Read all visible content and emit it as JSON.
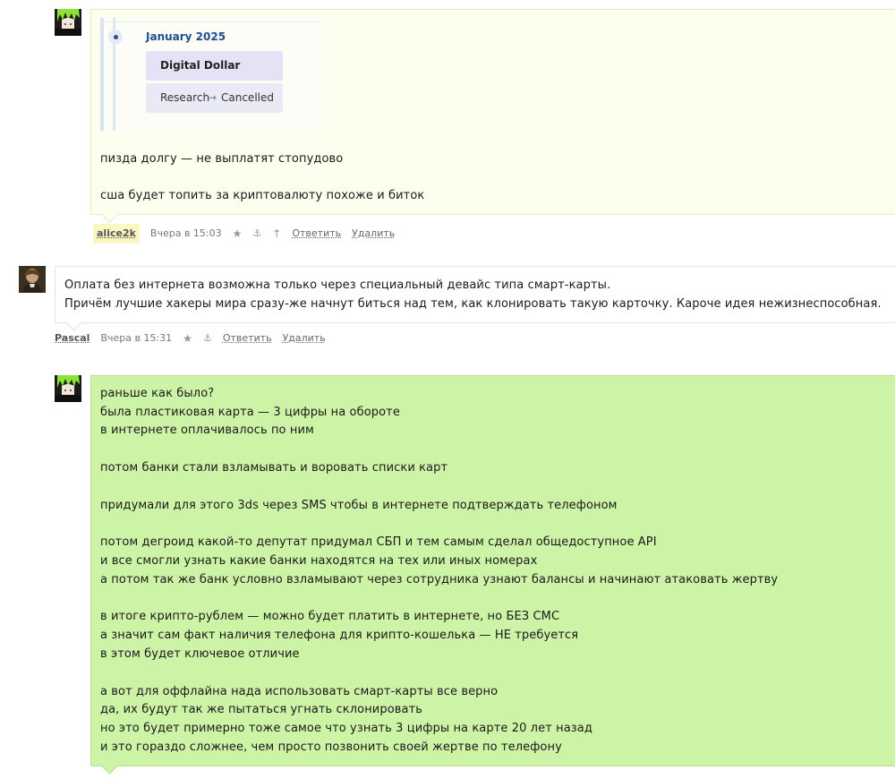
{
  "comments": [
    {
      "author": "alice2k",
      "avatar_icon": "green-hair-avatar",
      "embed": {
        "month": "January 2025",
        "title": "Digital Dollar",
        "status_from": "Research",
        "arrow": "→",
        "status_to": "Cancelled"
      },
      "lines": [
        "пизда долгу — не выплатят стопудово",
        "",
        "сша будет топить за криптовалюту похоже и биток"
      ],
      "time": "Вчера в 15:03",
      "star_icon": "★",
      "anchor_icon": "⚓",
      "up_icon": "↑",
      "reply_label": "Ответить",
      "delete_label": "Удалить"
    },
    {
      "author": "Pascal",
      "avatar_icon": "portrait-avatar",
      "lines": [
        "Оплата без интернета возможна только через специальный девайс типа смарт-карты.",
        "Причём лучшие хакеры мира сразу-же начнут биться над тем, как клонировать такую карточку. Кароче идея нежизнеспособная."
      ],
      "time": "Вчера в 15:31",
      "star_icon": "★",
      "anchor_icon": "⚓",
      "reply_label": "Ответить",
      "delete_label": "Удалить"
    },
    {
      "author": "alice2k",
      "avatar_icon": "green-hair-avatar",
      "lines": [
        "раньше как было?",
        "была пластиковая карта — 3 цифры на обороте",
        "в интернете оплачивалось по ним",
        "",
        "потом банки стали взламывать и воровать списки карт",
        "",
        "придумали для этого 3ds через SMS чтобы в интернете подтверждать телефоном",
        "",
        "потом дегроид какой-то депутат придумал СБП и тем самым сделал общедоступное API",
        "и все смогли узнать какие банки находятся на тех или иных номерах",
        "а потом так же банк условно взламывают через сотрудника узнают балансы и начинают атаковать жертву",
        "",
        "в итоге крипто-рублем — можно будет платить в интернете, но БЕЗ СМС",
        "а значит сам факт наличия телефона для крипто-кошелька — НЕ требуется",
        "в этом будет ключевое отличие",
        "",
        "а вот для оффлайна нада использовать смарт-карты все верно",
        "да, их будут так же пытаться угнать склонировать",
        "но это будет примерно тоже самое что узнать 3 цифры на карте 20 лет назад",
        "и это гораздо сложнее, чем просто позвонить своей жертве по телефону"
      ]
    }
  ],
  "colors": {
    "highlight_bubble": "#fefeee",
    "own_bubble": "#ccf3a6",
    "month_text": "#1f4e8c"
  }
}
